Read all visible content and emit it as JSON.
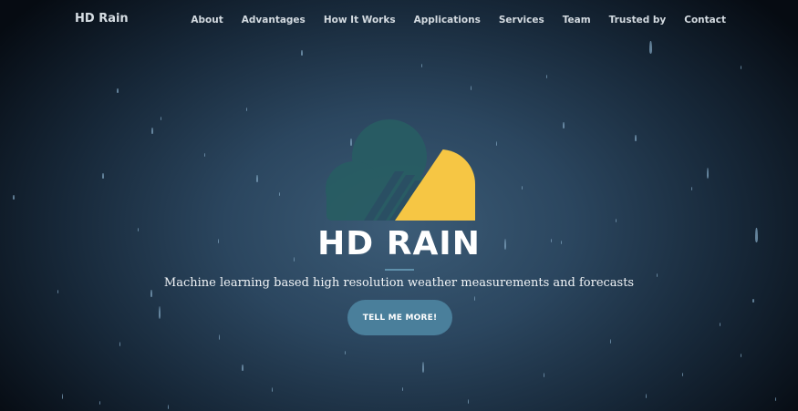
{
  "brand": "HD Rain",
  "nav": {
    "links": [
      "About",
      "Advantages",
      "How It Works",
      "Applications",
      "Services",
      "Team",
      "Trusted by",
      "Contact"
    ]
  },
  "hero": {
    "title": "HD RAIN",
    "subtitle": "Machine learning based high resolution weather measurements and forecasts",
    "cta_label": "TELL ME MORE!"
  },
  "colors": {
    "accent": "#4a7f9b",
    "logo_cloud": "#285d63",
    "logo_sun": "#f6c644",
    "background_center": "#3c5c77",
    "background_edge": "#060b12"
  },
  "icons": {
    "logo": "cloud-sun-rain-logo",
    "background": "raindrops"
  }
}
